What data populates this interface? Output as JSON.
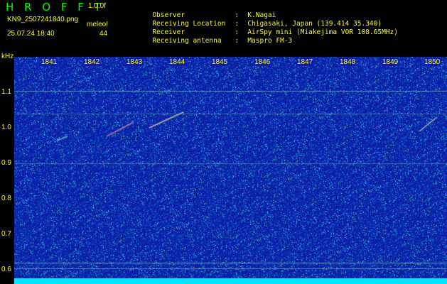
{
  "header": {
    "brand": "H R O F F T",
    "version": "1.0.0f",
    "file": "KN9_2507241840.png",
    "datetime": "25.07.24 18:40",
    "meleo_label": "meleo!",
    "meleo_value": "44"
  },
  "info": [
    {
      "label": "Observer",
      "value": "K.Nagai"
    },
    {
      "label": "Receiving Location",
      "value": "Chigasaki, Japan (139.414 35.340)"
    },
    {
      "label": "Receiver",
      "value": "AirSpy mini (Miakejima VOR 108.65MHz)"
    },
    {
      "label": "Receiving antenna",
      "value": "Maspro FM-3"
    }
  ],
  "separator": ":",
  "y_axis": {
    "unit": "kHz",
    "ticks": [
      "1.1",
      "1.0",
      "0.9",
      "0.8",
      "0.7",
      "0.6"
    ],
    "values": [
      1.1,
      1.0,
      0.9,
      0.8,
      0.7,
      0.6
    ]
  },
  "x_axis": {
    "ticks": [
      "1841",
      "1842",
      "1843",
      "1844",
      "1845",
      "1846",
      "1847",
      "1848",
      "1849",
      "1850"
    ]
  },
  "colors": {
    "background": "#0c1fa6",
    "text_yellow": "#ffff00",
    "brand_green": "#00ff00",
    "bottom_band": "#00e6ff"
  }
}
